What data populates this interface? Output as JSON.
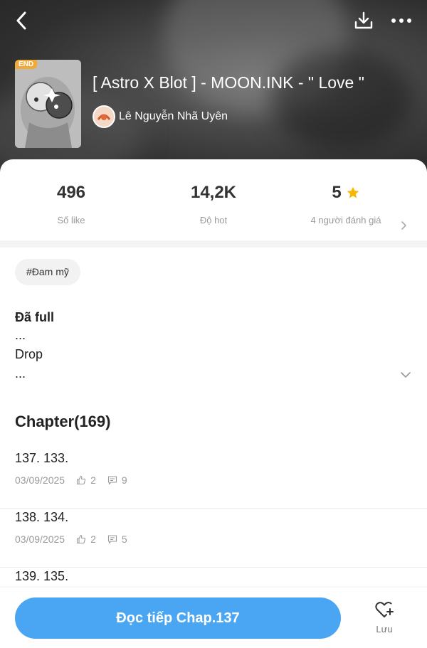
{
  "header": {
    "back_icon": "chevron-left-icon",
    "download_icon": "download-icon",
    "more_icon": "more-horizontal-icon"
  },
  "book": {
    "badge": "END",
    "title": "[ Astro X Blot ] - MOON.INK - \" Love \"",
    "author": "Lê Nguyễn Nhã Uyên"
  },
  "stats": {
    "likes": {
      "value": "496",
      "label": "Số like"
    },
    "hot": {
      "value": "14,2K",
      "label": "Độ hot"
    },
    "rating": {
      "value": "5",
      "label": "4 người đánh giá",
      "star_color": "#f5b700"
    }
  },
  "tags": [
    "#Đam mỹ"
  ],
  "description": [
    "Đã full",
    "...",
    "Drop",
    "..."
  ],
  "chapters": {
    "heading": "Chapter(169)",
    "items": [
      {
        "title": "137. 133.",
        "date": "03/09/2025",
        "likes": "2",
        "comments": "9"
      },
      {
        "title": "138. 134.",
        "date": "03/09/2025",
        "likes": "2",
        "comments": "5"
      },
      {
        "title": "139. 135.",
        "date": "",
        "likes": "",
        "comments": ""
      }
    ]
  },
  "actions": {
    "read_label": "Đọc tiếp Chap.137",
    "save_label": "Lưu"
  },
  "colors": {
    "accent": "#4aa6f3",
    "badge": "#f0a93a"
  }
}
